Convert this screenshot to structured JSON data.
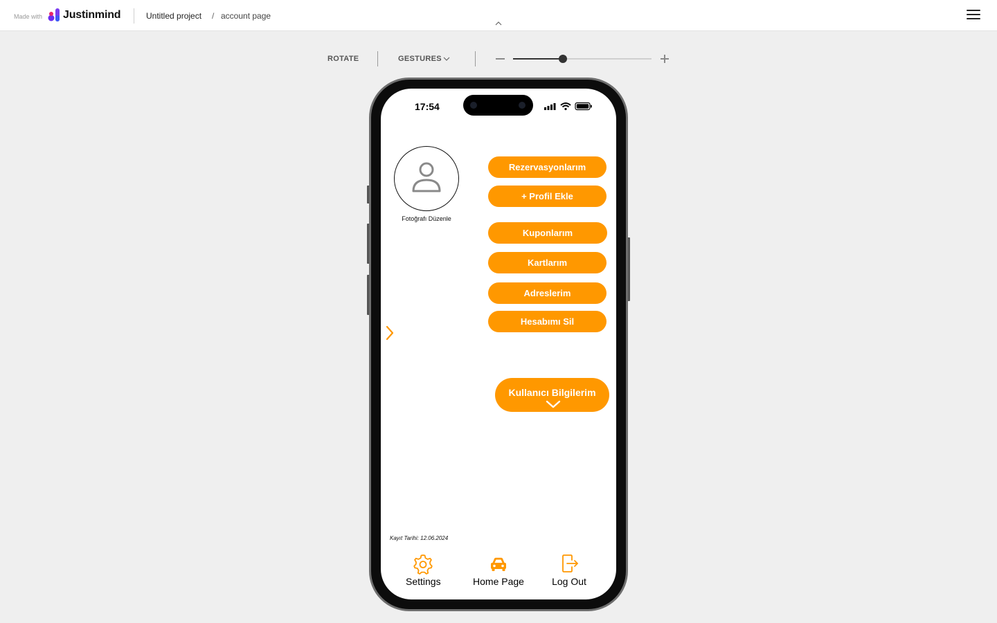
{
  "header": {
    "made_with": "Made with",
    "brand": "Justinmind",
    "project": "Untitled project",
    "separator": "/",
    "page": "account page"
  },
  "simulator": {
    "rotate_label": "ROTATE",
    "gestures_label": "GESTURES",
    "zoom_level": 0.36
  },
  "status_bar": {
    "time": "17:54"
  },
  "profile": {
    "edit_photo_label": "Fotoğrafı Düzenle"
  },
  "menu": {
    "reservations": "Rezervasyonlarım",
    "add_profile": "+ Profil Ekle",
    "coupons": "Kuponlarım",
    "cards": "Kartlarım",
    "addresses": "Adreslerim",
    "delete_account": "Hesabımı Sil",
    "user_info": "Kullanıcı Bilgilerim"
  },
  "registration": {
    "label": "Kayıt Tarihi: 12.06.2024"
  },
  "bottom_nav": {
    "settings": "Settings",
    "home": "Home Page",
    "logout": "Log Out"
  },
  "colors": {
    "accent": "#ff9800",
    "page_bg": "#efefef",
    "phone_frame": "#0c0c0c"
  }
}
